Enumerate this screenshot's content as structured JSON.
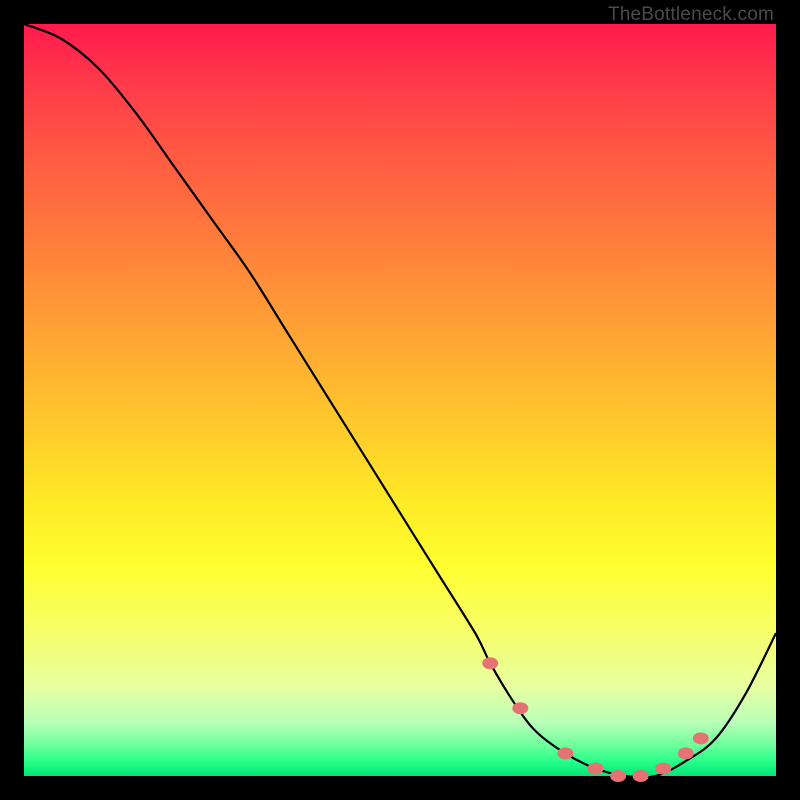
{
  "watermark": "TheBottleneck.com",
  "chart_data": {
    "type": "line",
    "title": "",
    "xlabel": "",
    "ylabel": "",
    "xlim": [
      0,
      100
    ],
    "ylim": [
      0,
      100
    ],
    "grid": false,
    "curve_x": [
      0,
      5,
      10,
      15,
      20,
      25,
      30,
      35,
      40,
      45,
      50,
      55,
      60,
      62,
      65,
      68,
      72,
      76,
      80,
      84,
      88,
      92,
      96,
      100
    ],
    "curve_values": [
      100,
      98,
      94,
      88,
      81,
      74,
      67,
      59,
      51,
      43,
      35,
      27,
      19,
      15,
      10,
      6,
      3,
      1,
      0,
      0,
      2,
      5,
      11,
      19
    ],
    "markers": {
      "x": [
        62,
        66,
        72,
        76,
        79,
        82,
        85,
        88,
        90
      ],
      "values": [
        15,
        9,
        3,
        1,
        0,
        0,
        1,
        3,
        5
      ]
    },
    "colors": {
      "curve": "#000000",
      "marker_fill": "#e57373",
      "marker_stroke": "#c94f4f"
    }
  }
}
